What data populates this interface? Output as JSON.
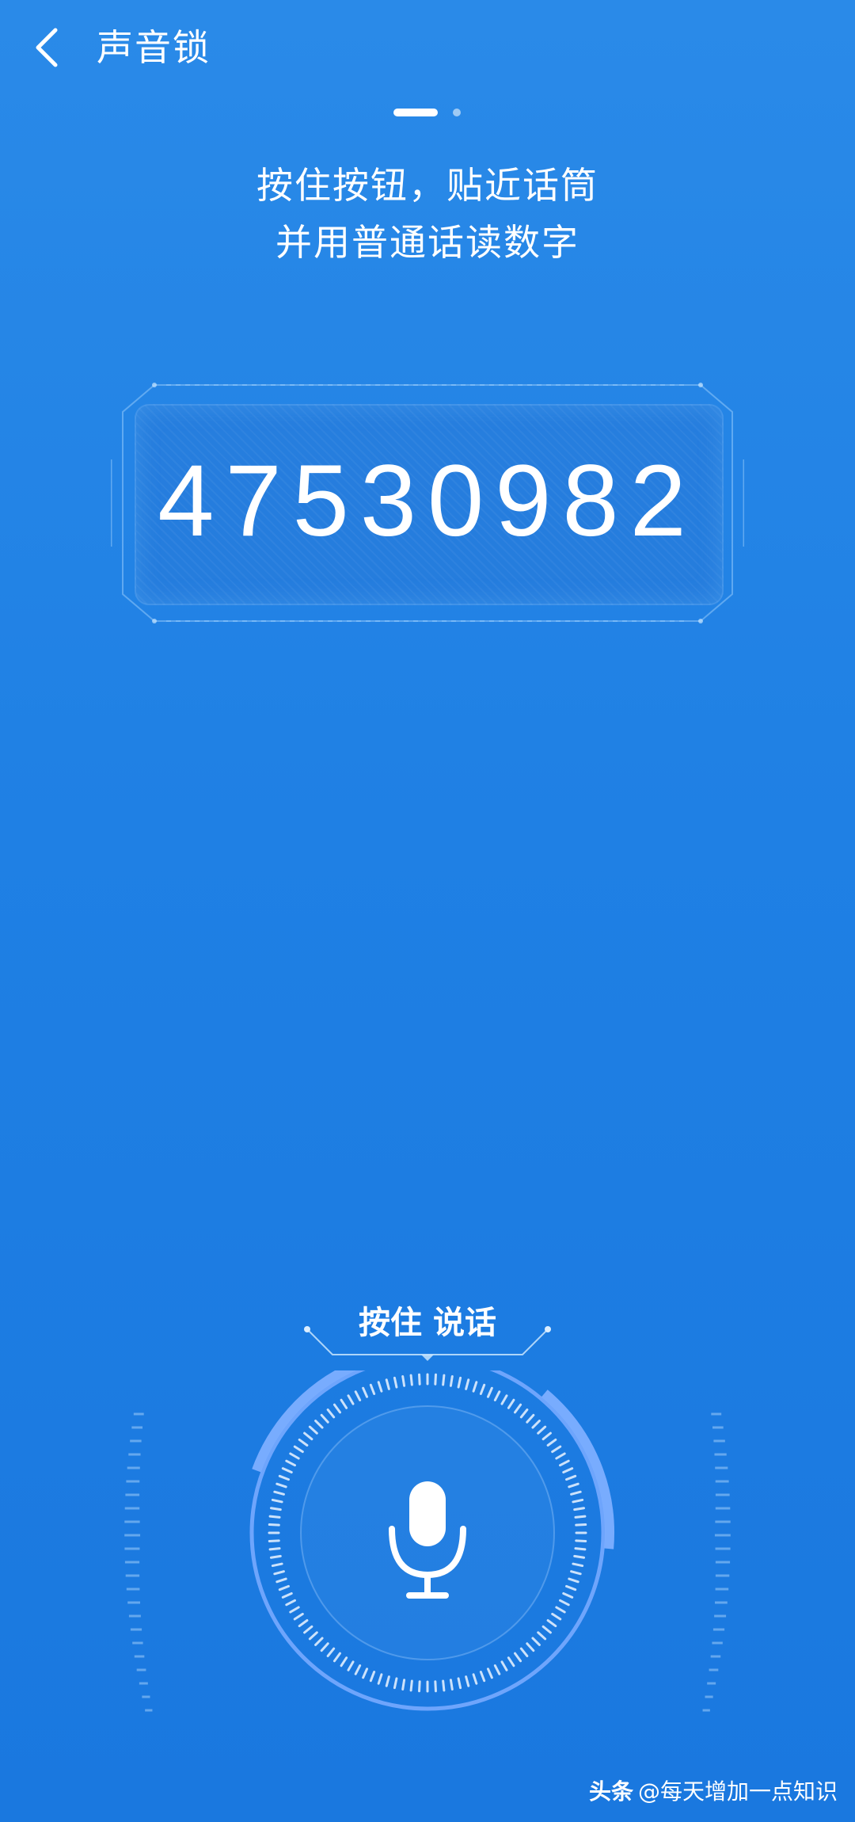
{
  "header": {
    "title": "声音锁",
    "back_icon": "chevron-left-icon"
  },
  "pager": {
    "current": 1,
    "total": 2
  },
  "instruction": {
    "line1": "按住按钮，贴近话筒",
    "line2": "并用普通话读数字"
  },
  "code": {
    "digits": "47530982"
  },
  "mic": {
    "label": "按住 说话",
    "icon": "microphone-icon"
  },
  "watermark": {
    "brand": "头条",
    "account": "@每天增加一点知识"
  },
  "colors": {
    "background_top": "#2a8ae8",
    "background_bottom": "#1a78df",
    "ring": "#6fa8ff",
    "text": "#ffffff"
  }
}
